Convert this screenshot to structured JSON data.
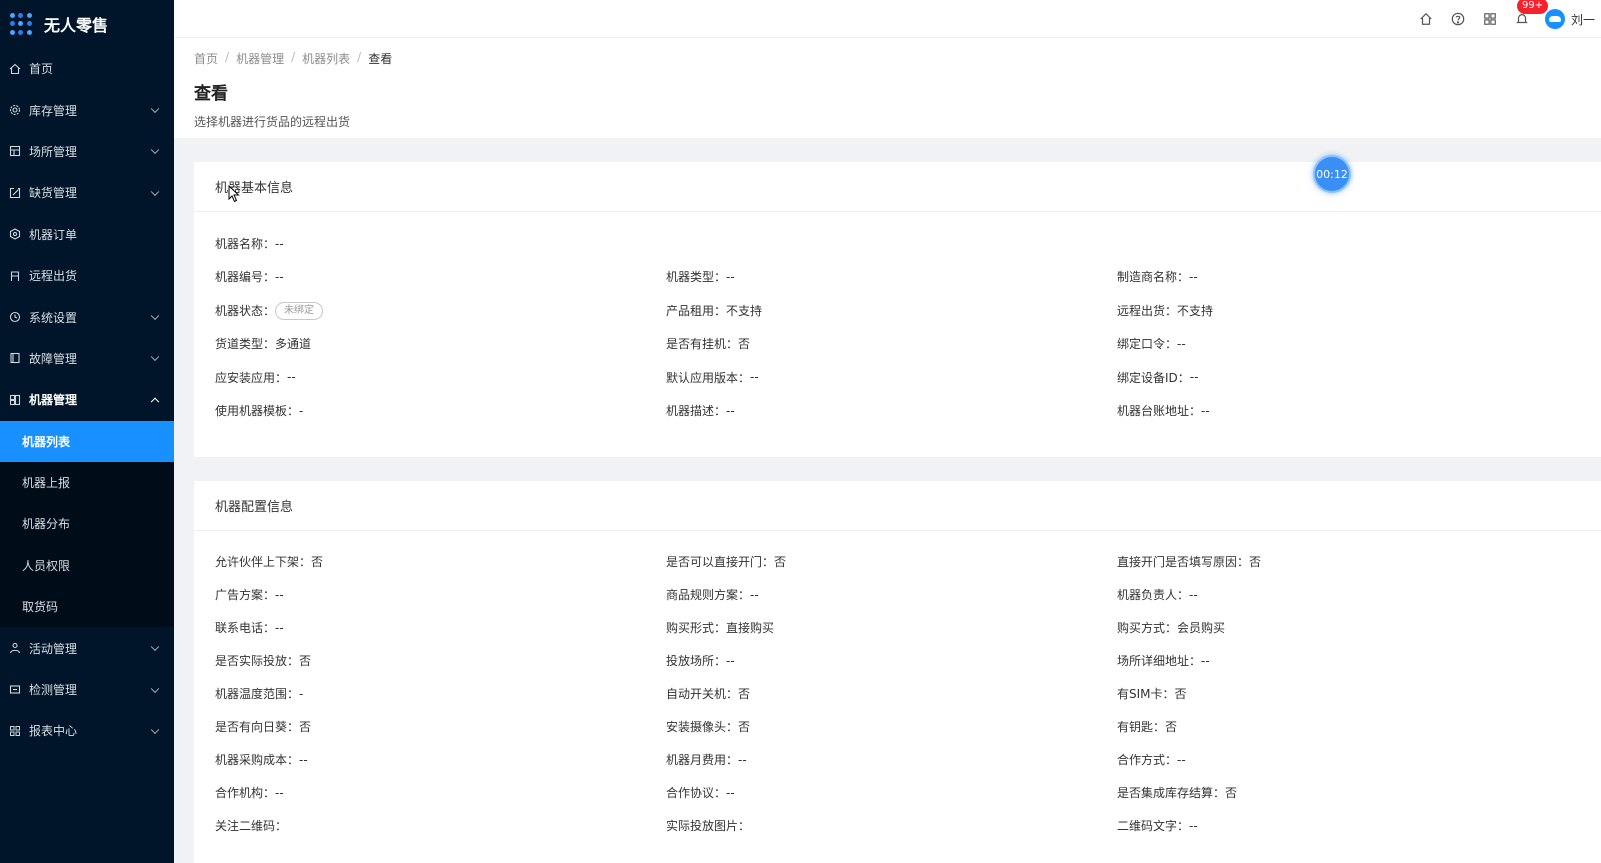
{
  "app": {
    "title": "无人零售"
  },
  "sidebar": {
    "items": [
      {
        "label": "首页",
        "icon": "home-icon",
        "has_arrow": false
      },
      {
        "label": "库存管理",
        "icon": "gear-icon",
        "has_arrow": true
      },
      {
        "label": "场所管理",
        "icon": "building-icon",
        "has_arrow": true
      },
      {
        "label": "缺货管理",
        "icon": "export-icon",
        "has_arrow": true
      },
      {
        "label": "机器订单",
        "icon": "settings-icon",
        "has_arrow": false
      },
      {
        "label": "远程出货",
        "icon": "box-icon",
        "has_arrow": false
      },
      {
        "label": "系统设置",
        "icon": "clock-icon",
        "has_arrow": true
      },
      {
        "label": "故障管理",
        "icon": "book-icon",
        "has_arrow": true
      },
      {
        "label": "机器管理",
        "icon": "machine-icon",
        "has_arrow": true,
        "open": true
      }
    ],
    "submenu": [
      "机器列表",
      "机器上报",
      "机器分布",
      "人员权限",
      "取货码"
    ],
    "submenu_active": "机器列表",
    "items_after": [
      {
        "label": "活动管理",
        "icon": "user-icon",
        "has_arrow": true
      },
      {
        "label": "检测管理",
        "icon": "monitor-icon",
        "has_arrow": true
      },
      {
        "label": "报表中心",
        "icon": "grid-icon",
        "has_arrow": true
      }
    ]
  },
  "topbar": {
    "badge": "99+",
    "username": "刘一"
  },
  "breadcrumb": [
    "首页",
    "机器管理",
    "机器列表",
    "查看"
  ],
  "page": {
    "title": "查看",
    "description": "选择机器进行货品的远程出货"
  },
  "timer": "00:12",
  "basic_info": {
    "title": "机器基本信息",
    "fields": [
      {
        "label": "机器名称：",
        "value": "--"
      },
      {
        "label": "机器编号：",
        "value": "--"
      },
      {
        "label": "机器类型：",
        "value": "--"
      },
      {
        "label": "制造商名称：",
        "value": "--"
      },
      {
        "label": "机器状态：",
        "value": "未绑定",
        "tag": true
      },
      {
        "label": "产品租用：",
        "value": "不支持"
      },
      {
        "label": "远程出货：",
        "value": "不支持"
      },
      {
        "label": "货道类型：",
        "value": "多通道"
      },
      {
        "label": "是否有挂机：",
        "value": "否"
      },
      {
        "label": "绑定口令：",
        "value": "--"
      },
      {
        "label": "应安装应用：",
        "value": "--"
      },
      {
        "label": "默认应用版本：",
        "value": "--"
      },
      {
        "label": "绑定设备ID：",
        "value": "--"
      },
      {
        "label": "使用机器模板：",
        "value": "-"
      },
      {
        "label": "机器描述：",
        "value": "--"
      },
      {
        "label": "机器台账地址：",
        "value": "--"
      }
    ]
  },
  "config_info": {
    "title": "机器配置信息",
    "fields": [
      {
        "label": "允许伙伴上下架：",
        "value": "否"
      },
      {
        "label": "是否可以直接开门：",
        "value": "否"
      },
      {
        "label": "直接开门是否填写原因：",
        "value": "否"
      },
      {
        "label": "广告方案：",
        "value": "--"
      },
      {
        "label": "商品规则方案：",
        "value": "--"
      },
      {
        "label": "机器负责人：",
        "value": "--"
      },
      {
        "label": "联系电话：",
        "value": "--"
      },
      {
        "label": "购买形式：",
        "value": "直接购买"
      },
      {
        "label": "购买方式：",
        "value": "会员购买"
      },
      {
        "label": "是否实际投放：",
        "value": "否"
      },
      {
        "label": "投放场所：",
        "value": "--"
      },
      {
        "label": "场所详细地址：",
        "value": "--"
      },
      {
        "label": "机器温度范围：",
        "value": "-"
      },
      {
        "label": "自动开关机：",
        "value": "否"
      },
      {
        "label": "有SIM卡：",
        "value": "否"
      },
      {
        "label": "是否有向日葵：",
        "value": "否"
      },
      {
        "label": "安装摄像头：",
        "value": "否"
      },
      {
        "label": "有钥匙：",
        "value": "否"
      },
      {
        "label": "机器采购成本：",
        "value": "--"
      },
      {
        "label": "机器月费用：",
        "value": "--"
      },
      {
        "label": "合作方式：",
        "value": "--"
      },
      {
        "label": "合作机构：",
        "value": "--"
      },
      {
        "label": "合作协议：",
        "value": "--"
      },
      {
        "label": "是否集成库存结算：",
        "value": "否"
      },
      {
        "label": "关注二维码：",
        "value": ""
      },
      {
        "label": "实际投放图片：",
        "value": ""
      },
      {
        "label": "二维码文字：",
        "value": "--"
      }
    ]
  }
}
